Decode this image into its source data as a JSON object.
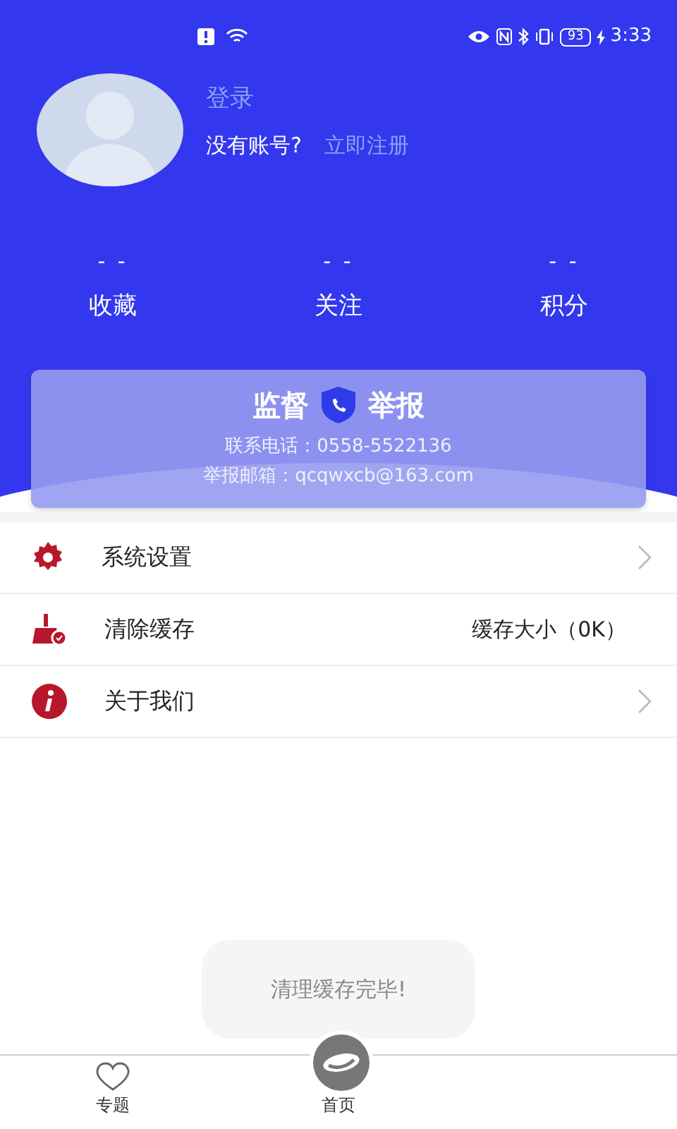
{
  "status_bar": {
    "battery": "93",
    "time": "3:33"
  },
  "profile": {
    "login": "登录",
    "no_account": "没有账号?",
    "register": "立即注册"
  },
  "stats": [
    {
      "value": "- -",
      "label": "收藏"
    },
    {
      "value": "- -",
      "label": "关注"
    },
    {
      "value": "- -",
      "label": "积分"
    }
  ],
  "report_card": {
    "title_left": "监督",
    "title_right": "举报",
    "phone": "联系电话：0558-5522136",
    "email": "举报邮箱：qcqwxcb@163.com"
  },
  "menu": [
    {
      "kind": "settings",
      "label": "系统设置"
    },
    {
      "kind": "clear",
      "label": "清除缓存",
      "detail": "缓存大小（0K）"
    },
    {
      "kind": "about",
      "label": "关于我们"
    }
  ],
  "toast": "清理缓存完毕!",
  "tabs": [
    {
      "kind": "heart",
      "label": "专题",
      "selected": false
    },
    {
      "kind": "logo",
      "label": "首页",
      "selected": false
    }
  ]
}
